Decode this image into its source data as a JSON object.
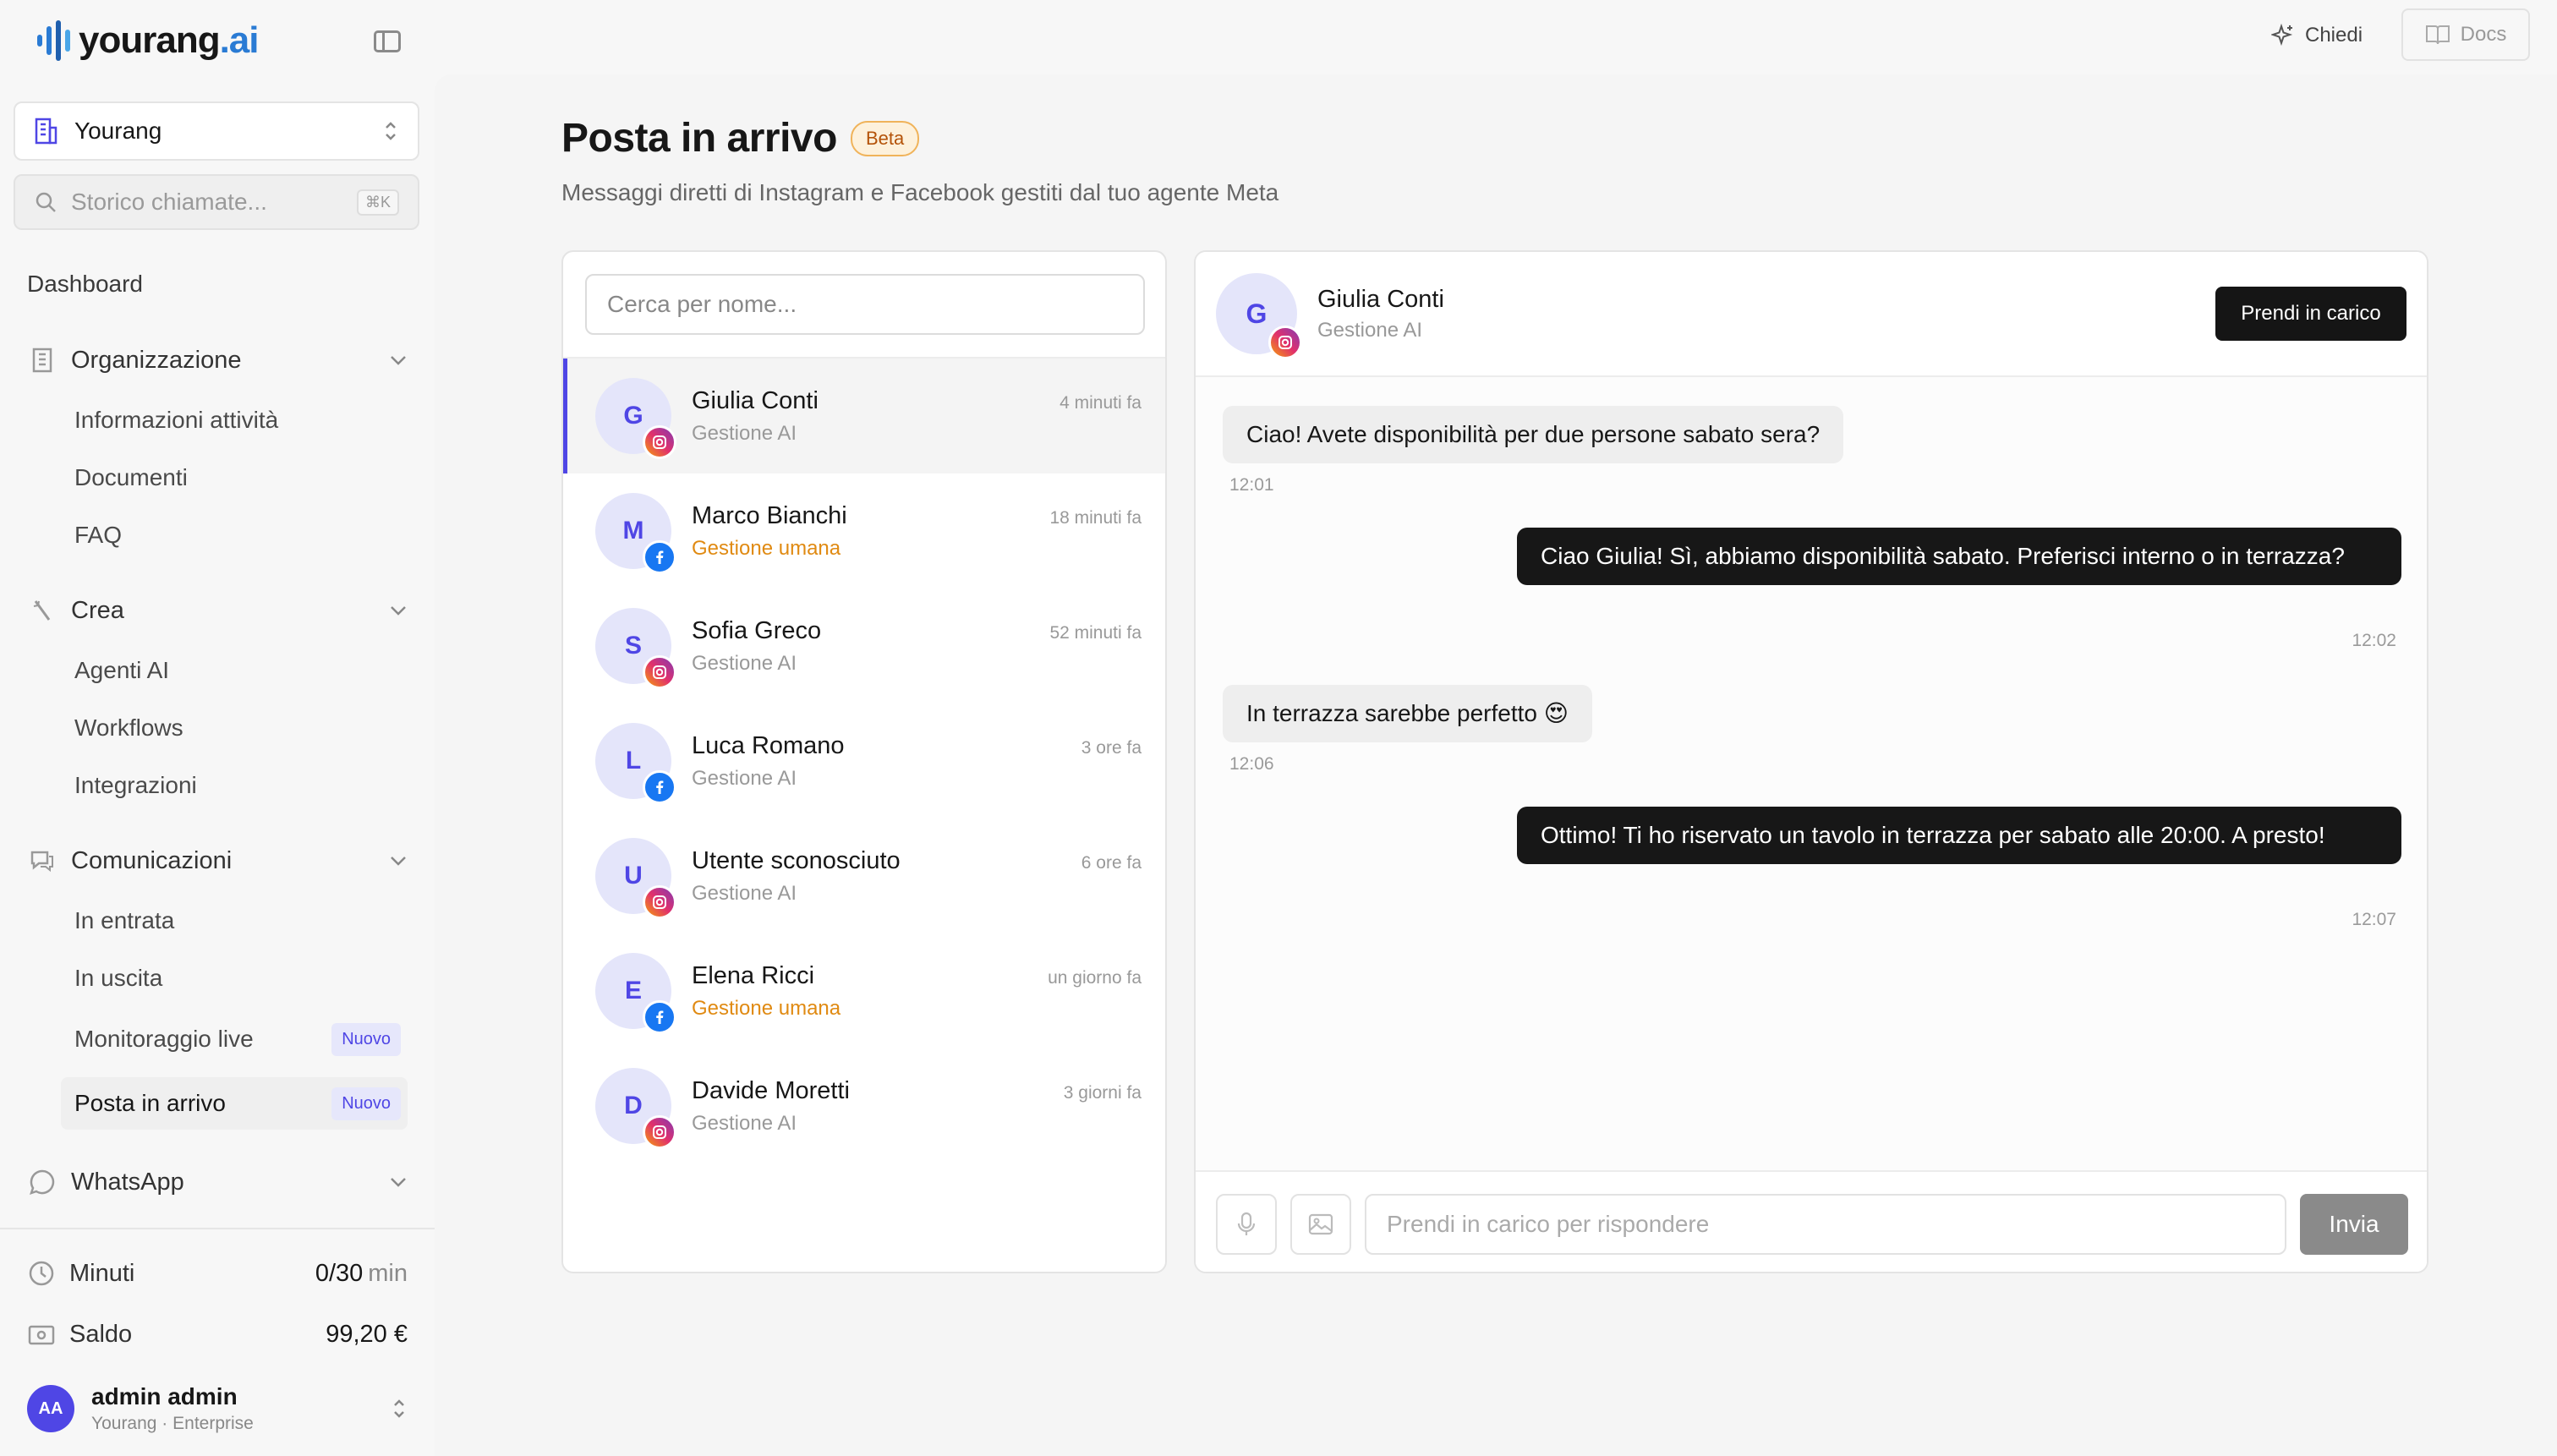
{
  "brand": {
    "logo_main": "yourang",
    "logo_suffix": ".ai",
    "accent": "#2a7bd4",
    "primary": "#4f46e5"
  },
  "sidebar": {
    "org_name": "Yourang",
    "search_placeholder": "Storico chiamate...",
    "search_shortcut": "⌘K",
    "dashboard": "Dashboard",
    "sections": [
      {
        "label": "Organizzazione",
        "icon": "building-icon",
        "items": [
          {
            "label": "Informazioni attività"
          },
          {
            "label": "Documenti"
          },
          {
            "label": "FAQ"
          }
        ]
      },
      {
        "label": "Crea",
        "icon": "wand-icon",
        "items": [
          {
            "label": "Agenti AI"
          },
          {
            "label": "Workflows"
          },
          {
            "label": "Integrazioni"
          }
        ]
      },
      {
        "label": "Comunicazioni",
        "icon": "chat-icon",
        "items": [
          {
            "label": "In entrata"
          },
          {
            "label": "In uscita"
          },
          {
            "label": "Monitoraggio live",
            "badge": "Nuovo"
          },
          {
            "label": "Posta in arrivo",
            "badge": "Nuovo",
            "active": true
          }
        ]
      },
      {
        "label": "WhatsApp",
        "icon": "whatsapp-icon",
        "items": []
      }
    ],
    "footer": {
      "minutes_label": "Minuti",
      "minutes_value": "0/30",
      "minutes_unit": "min",
      "balance_label": "Saldo",
      "balance_value": "99,20 €",
      "user_initials": "AA",
      "user_name": "admin admin",
      "user_sub": "Yourang · Enterprise"
    }
  },
  "topbar": {
    "ask_label": "Chiedi",
    "docs_label": "Docs"
  },
  "page": {
    "title": "Posta in arrivo",
    "badge": "Beta",
    "subtitle": "Messaggi diretti di Instagram e Facebook gestiti dal tuo agente Meta"
  },
  "inbox": {
    "search_placeholder": "Cerca per nome...",
    "conversations": [
      {
        "initial": "G",
        "name": "Giulia Conti",
        "time": "4 minuti fa",
        "status": "Gestione AI",
        "platform": "instagram",
        "human": false,
        "active": true
      },
      {
        "initial": "M",
        "name": "Marco Bianchi",
        "time": "18 minuti fa",
        "status": "Gestione umana",
        "platform": "facebook",
        "human": true,
        "active": false
      },
      {
        "initial": "S",
        "name": "Sofia Greco",
        "time": "52 minuti fa",
        "status": "Gestione AI",
        "platform": "instagram",
        "human": false,
        "active": false
      },
      {
        "initial": "L",
        "name": "Luca Romano",
        "time": "3 ore fa",
        "status": "Gestione AI",
        "platform": "facebook",
        "human": false,
        "active": false
      },
      {
        "initial": "U",
        "name": "Utente sconosciuto",
        "time": "6 ore fa",
        "status": "Gestione AI",
        "platform": "instagram",
        "human": false,
        "active": false
      },
      {
        "initial": "E",
        "name": "Elena Ricci",
        "time": "un giorno fa",
        "status": "Gestione umana",
        "platform": "facebook",
        "human": true,
        "active": false
      },
      {
        "initial": "D",
        "name": "Davide Moretti",
        "time": "3 giorni fa",
        "status": "Gestione AI",
        "platform": "instagram",
        "human": false,
        "active": false
      }
    ]
  },
  "chat": {
    "contact_initial": "G",
    "contact_name": "Giulia Conti",
    "contact_status": "Gestione AI",
    "take_over_label": "Prendi in carico",
    "messages": [
      {
        "direction": "in",
        "text": "Ciao! Avete disponibilità per due persone sabato sera?",
        "time": "12:01"
      },
      {
        "direction": "out",
        "text": "Ciao Giulia! Sì, abbiamo disponibilità sabato. Preferisci interno o in terrazza?",
        "time": "12:02"
      },
      {
        "direction": "in",
        "text": "In terrazza sarebbe perfetto 😍",
        "time": "12:06"
      },
      {
        "direction": "out",
        "text": "Ottimo! Ti ho riservato un tavolo in terrazza per sabato alle 20:00. A presto!",
        "time": "12:07"
      }
    ],
    "input_placeholder": "Prendi in carico per rispondere",
    "send_label": "Invia"
  }
}
